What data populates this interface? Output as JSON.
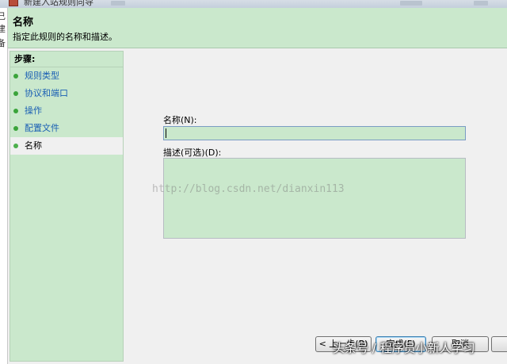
{
  "window": {
    "title": "新建入站规则向导"
  },
  "left_clip": [
    "己",
    "建",
    "备"
  ],
  "header": {
    "title": "名称",
    "description": "指定此规则的名称和描述。"
  },
  "steps": {
    "heading": "步骤:",
    "items": [
      {
        "label": "规则类型"
      },
      {
        "label": "协议和端口"
      },
      {
        "label": "操作"
      },
      {
        "label": "配置文件"
      },
      {
        "label": "名称"
      }
    ],
    "current_index": 4
  },
  "form": {
    "name_label": "名称(N):",
    "name_value": "",
    "description_label": "描述(可选)(D):",
    "description_value": ""
  },
  "buttons": {
    "back": "< 上一步(B)",
    "finish": "完成(F)",
    "cancel": "取消"
  },
  "watermark": "http://blog.csdn.net/dianxin113",
  "overlay_caption": "头条号 / 程序员小新人学习",
  "colors": {
    "panel_green": "#cae8cc",
    "link_blue": "#1a5fb4",
    "window_bg": "#f0f0f0"
  }
}
